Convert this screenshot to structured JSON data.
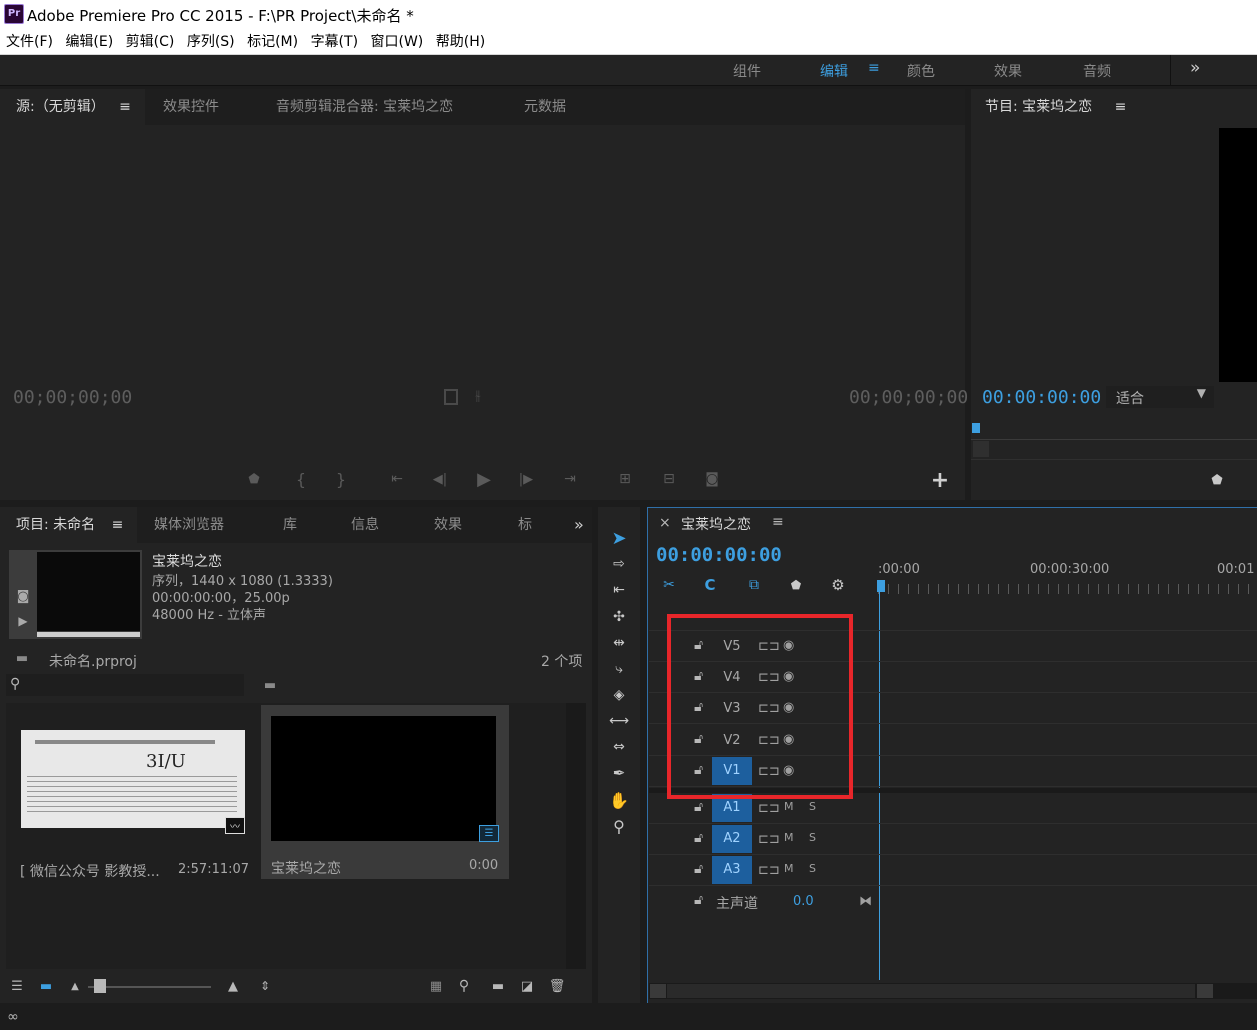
{
  "app": {
    "logo": "Pr",
    "title": "Adobe Premiere Pro CC 2015 - F:\\PR Project\\未命名 *"
  },
  "menu": [
    "文件(F)",
    "编辑(E)",
    "剪辑(C)",
    "序列(S)",
    "标记(M)",
    "字幕(T)",
    "窗口(W)",
    "帮助(H)"
  ],
  "workspaces": {
    "items": [
      "组件",
      "编辑",
      "颜色",
      "效果",
      "音频"
    ],
    "active": "编辑",
    "more": "»"
  },
  "source_panel": {
    "tabs": [
      "源:（无剪辑）",
      "效果控件",
      "音频剪辑混合器: 宝莱坞之恋",
      "元数据"
    ],
    "timecode_left": "00;00;00;00",
    "timecode_right": "00;00;00;00",
    "add_button": "+"
  },
  "program_panel": {
    "title": "节目: 宝莱坞之恋",
    "timecode": "00:00:00:00",
    "fit": "适合"
  },
  "project_panel": {
    "tabs": [
      "项目: 未命名",
      "媒体浏览器",
      "库",
      "信息",
      "效果",
      "标记"
    ],
    "more": "»",
    "clip": {
      "name": "宝莱坞之恋",
      "line1": "序列，1440 x 1080 (1.3333)",
      "line2": "00:00:00:00，25.00p",
      "line3": "48000 Hz - 立体声"
    },
    "file_name": "未命名.prproj",
    "count": "2 个项",
    "items": [
      {
        "name": "[ 微信公众号 影教授...",
        "duration": "2:57:11:07",
        "thumb_text": "3I/U"
      },
      {
        "name": "宝莱坞之恋",
        "duration": "0:00"
      }
    ]
  },
  "timeline": {
    "close": "×",
    "title": "宝莱坞之恋",
    "timecode": "00:00:00:00",
    "ruler": [
      ":00:00",
      "00:00:30:00",
      "00:01"
    ],
    "video_tracks": [
      "V5",
      "V4",
      "V3",
      "V2",
      "V1"
    ],
    "audio_tracks": [
      "A1",
      "A2",
      "A3"
    ],
    "selected_track": "V1",
    "mute_label": "M",
    "solo_label": "S",
    "master_label": "主声道",
    "master_value": "0.0",
    "highlight_color": "#e8262a"
  }
}
